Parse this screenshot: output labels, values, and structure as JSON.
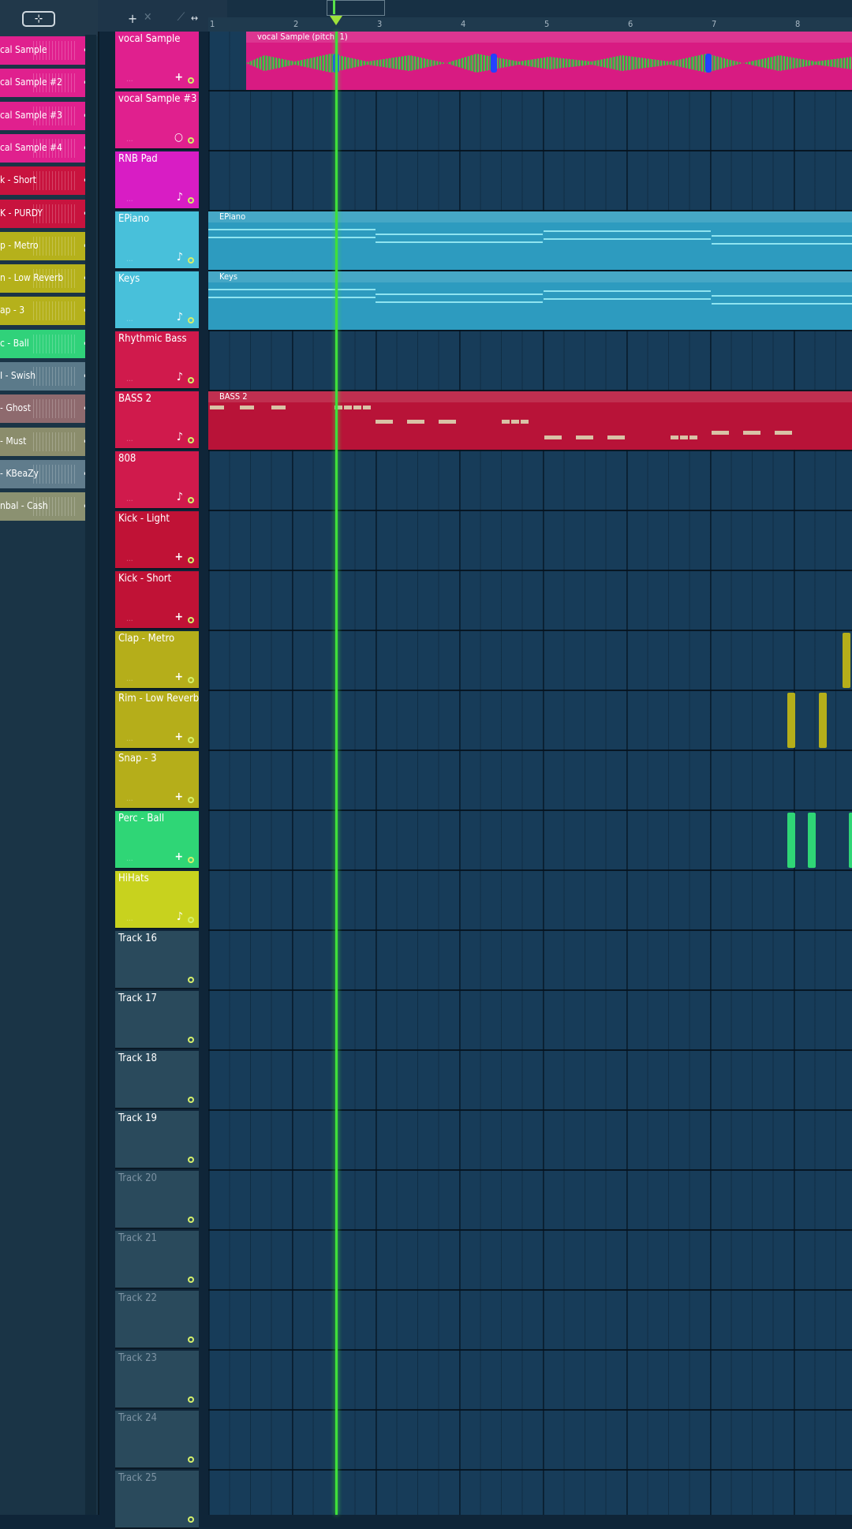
{
  "picker": {
    "button_icon": "waveform-icon",
    "clips": [
      {
        "label": "cal Sample",
        "color": "#e0208e"
      },
      {
        "label": "cal Sample #2",
        "color": "#e0208e"
      },
      {
        "label": "cal Sample #3",
        "color": "#e0208e"
      },
      {
        "label": "cal Sample #4",
        "color": "#e0208e"
      },
      {
        "label": "k - Short",
        "color": "#c8133e"
      },
      {
        "label": "K - PURDY",
        "color": "#c8133e"
      },
      {
        "label": "p - Metro",
        "color": "#b5b11b"
      },
      {
        "label": "n - Low Reverb",
        "color": "#b5b11b"
      },
      {
        "label": "ap - 3",
        "color": "#b5b11b"
      },
      {
        "label": "c - Ball",
        "color": "#30d27a"
      },
      {
        "label": "I - Swish",
        "color": "#5b7a8a"
      },
      {
        "label": "- Ghost",
        "color": "#8e6a6e"
      },
      {
        "label": "- Must",
        "color": "#8b8d6c"
      },
      {
        "label": "- KBeaZy",
        "color": "#607c8c"
      },
      {
        "label": "nbal - Cash",
        "color": "#8b9171"
      }
    ]
  },
  "timeline": {
    "bars": [
      "1",
      "2",
      "3",
      "4",
      "5",
      "6",
      "7",
      "8"
    ]
  },
  "tracks": [
    {
      "label": "vocal Sample",
      "color": "#e0208e",
      "icon": "+"
    },
    {
      "label": "vocal Sample #3",
      "color": "#e0208e",
      "icon": "○"
    },
    {
      "label": "RNB Pad",
      "color": "#d81dc4",
      "icon": "♪"
    },
    {
      "label": "EPiano",
      "color": "#48c0da",
      "icon": "♪"
    },
    {
      "label": "Keys",
      "color": "#48c0da",
      "icon": "♪"
    },
    {
      "label": "Rhythmic Bass",
      "color": "#d01a4c",
      "icon": "♪"
    },
    {
      "label": "BASS 2",
      "color": "#d01a4c",
      "icon": "♪"
    },
    {
      "label": "808",
      "color": "#d01a4c",
      "icon": "♪"
    },
    {
      "label": "Kick - Light",
      "color": "#c01236",
      "icon": "+"
    },
    {
      "label": "Kick - Short",
      "color": "#c01236",
      "icon": "+"
    },
    {
      "label": "Clap - Metro",
      "color": "#b5ae1a",
      "icon": "+"
    },
    {
      "label": "Rim - Low Reverb",
      "color": "#b5ae1a",
      "icon": "+"
    },
    {
      "label": "Snap - 3",
      "color": "#b5ae1a",
      "icon": "+"
    },
    {
      "label": "Perc - Ball",
      "color": "#2fd676",
      "icon": "+"
    },
    {
      "label": "HiHats",
      "color": "#c8d21e",
      "icon": "♪"
    },
    {
      "label": "Track 16",
      "color": "#2a4a5c",
      "icon": ""
    },
    {
      "label": "Track 17",
      "color": "#2a4a5c",
      "icon": ""
    },
    {
      "label": "Track 18",
      "color": "#2a4a5c",
      "icon": ""
    },
    {
      "label": "Track 19",
      "color": "#2a4a5c",
      "icon": ""
    },
    {
      "label": "Track 20",
      "color": "#2a4a5c",
      "icon": ""
    },
    {
      "label": "Track 21",
      "color": "#2a4a5c",
      "icon": ""
    },
    {
      "label": "Track 22",
      "color": "#2a4a5c",
      "icon": ""
    },
    {
      "label": "Track 23",
      "color": "#2a4a5c",
      "icon": ""
    },
    {
      "label": "Track 24",
      "color": "#2a4a5c",
      "icon": ""
    },
    {
      "label": "Track 25",
      "color": "#2a4a5c",
      "icon": ""
    }
  ],
  "clips": [
    {
      "track": 0,
      "label": "vocal Sample (pitch: 1)",
      "color": "#d81b82"
    },
    {
      "track": 3,
      "label": "EPiano",
      "color": "#2d9bbf"
    },
    {
      "track": 4,
      "label": "Keys",
      "color": "#2d9bbf"
    },
    {
      "track": 6,
      "label": "BASS 2",
      "color": "#b81338"
    }
  ]
}
